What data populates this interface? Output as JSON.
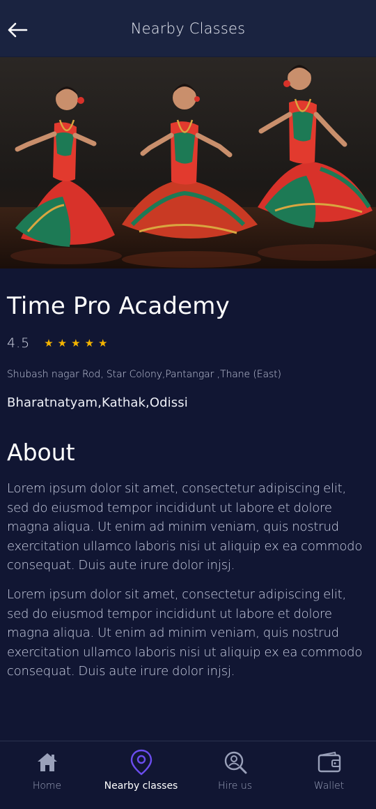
{
  "header": {
    "title": "Nearby Classes",
    "back_icon": "arrow-left-icon"
  },
  "hero": {
    "image_subject": "three Bharatnatyam dancers in red and green costumes",
    "colors": {
      "costume_red": "#d8322a",
      "costume_green": "#1d7a55",
      "gold": "#d9a640"
    }
  },
  "academy": {
    "name": "Time Pro Academy",
    "rating": "4.5",
    "star_count": 5,
    "star_color": "#f4b400",
    "address": "Shubash nagar Rod, Star Colony,Pantangar ,Thane (East)",
    "dance_styles": "Bharatnatyam,Kathak,Odissi"
  },
  "about": {
    "title": "About",
    "paragraphs": [
      "Lorem ipsum dolor sit amet, consectetur adipiscing elit, sed do eiusmod tempor incididunt ut labore et dolore magna aliqua. Ut enim ad minim veniam, quis nostrud exercitation ullamco laboris nisi ut aliquip ex ea commodo consequat. Duis aute irure dolor injsj.",
      "Lorem ipsum dolor sit amet, consectetur adipiscing elit, sed do eiusmod tempor incididunt ut labore et dolore magna aliqua. Ut enim ad minim veniam, quis nostrud exercitation ullamco laboris nisi ut aliquip ex ea commodo consequat. Duis aute irure dolor injsj."
    ]
  },
  "bottom_nav": {
    "items": [
      {
        "label": "Home",
        "icon": "home-icon",
        "active": false
      },
      {
        "label": "Nearby classes",
        "icon": "location-pin-icon",
        "active": true
      },
      {
        "label": "Hire us",
        "icon": "search-person-icon",
        "active": false
      },
      {
        "label": "Wallet",
        "icon": "wallet-icon",
        "active": false
      }
    ],
    "active_color": "#6b4df0"
  },
  "theme": {
    "background": "#111633",
    "app_bar": "#1a2340"
  }
}
